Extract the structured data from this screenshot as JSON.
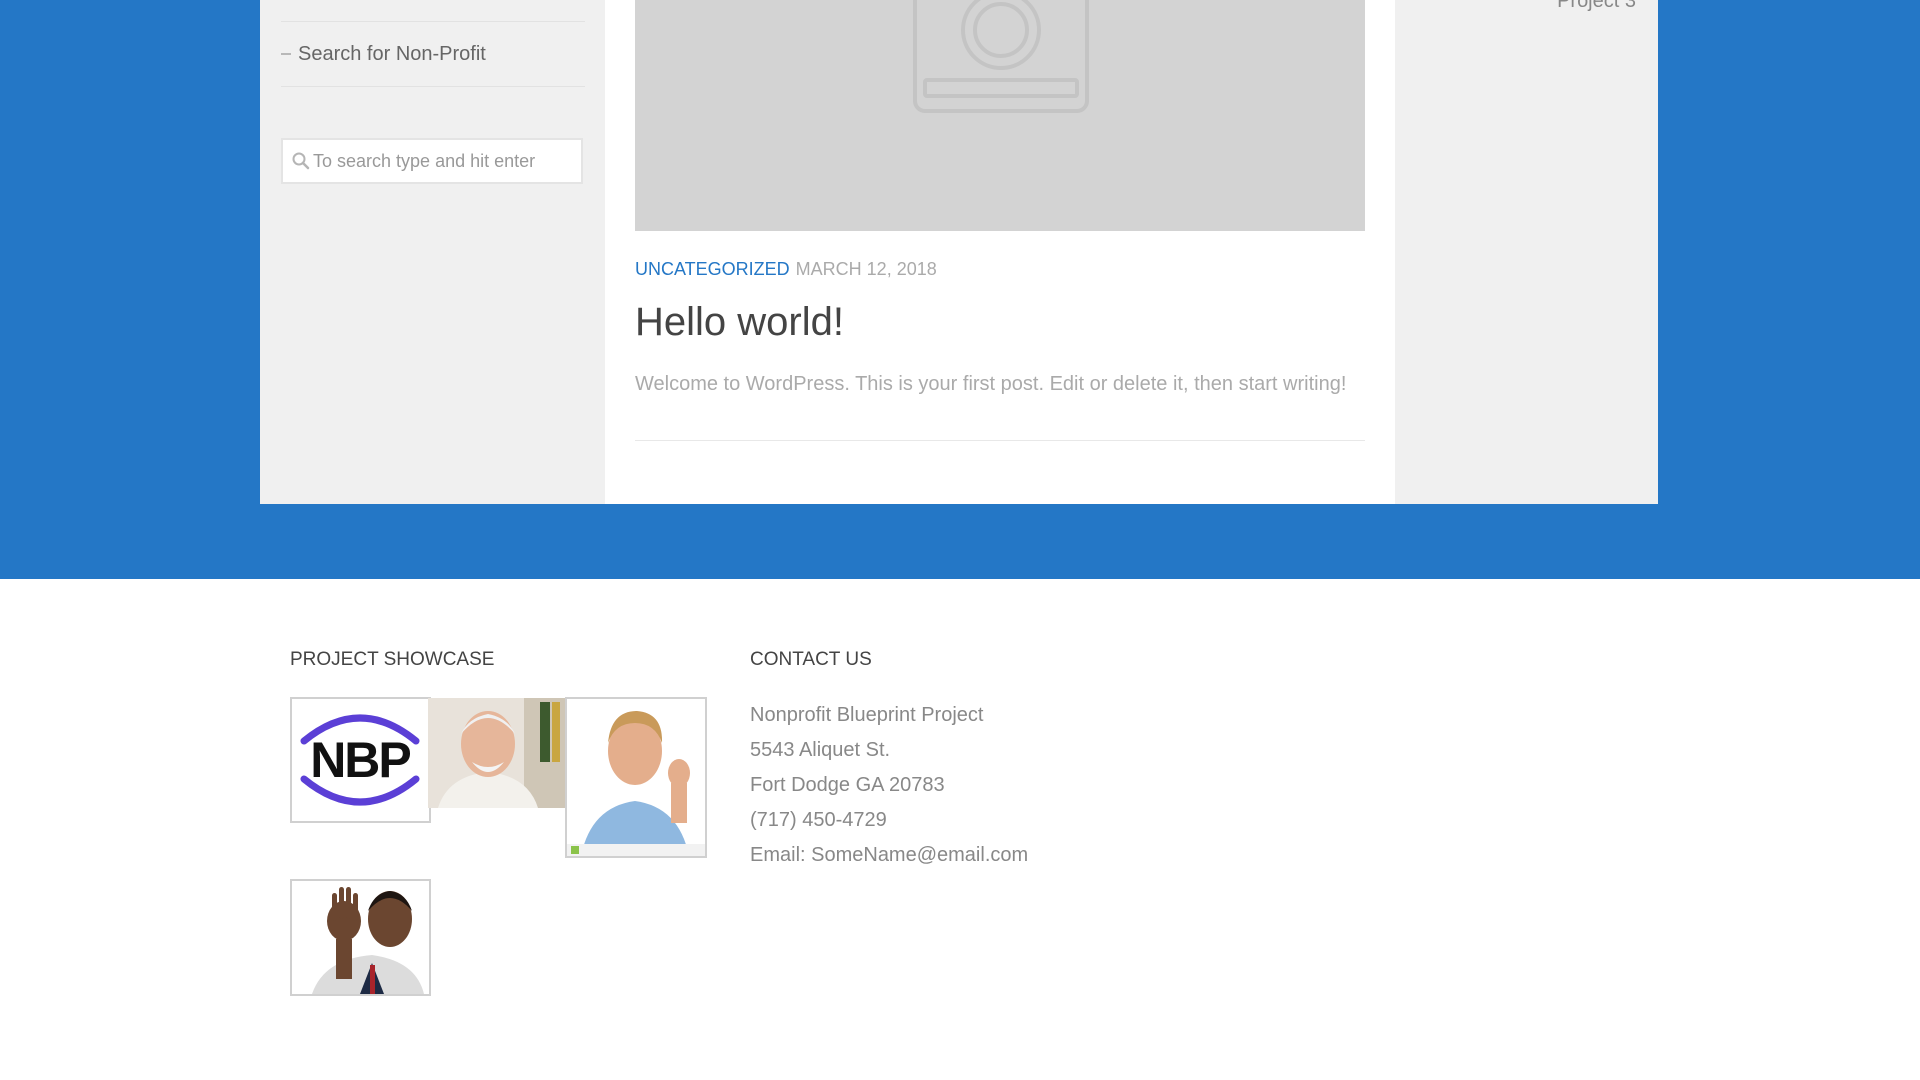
{
  "sidebar_left": {
    "nav_item": "Search for Non-Profit",
    "search_placeholder": "To search type and hit enter"
  },
  "post": {
    "category": "Uncategorized",
    "date": "March 12, 2018",
    "title": "Hello world!",
    "excerpt": "Welcome to WordPress. This is your first post. Edit or delete it, then start writing!",
    "image_icon": "camera-placeholder-icon"
  },
  "sidebar_right": {
    "link": "Project 3"
  },
  "footer": {
    "showcase": {
      "heading": "Project Showcase",
      "thumbnails": [
        {
          "name": "nbp-logo",
          "text": "NBP"
        },
        {
          "name": "older-man-photo"
        },
        {
          "name": "man-ok-gesture-photo"
        },
        {
          "name": "man-waving-photo"
        }
      ]
    },
    "contact": {
      "heading": "Contact Us",
      "org": "Nonprofit Blueprint Project",
      "street": "5543 Aliquet St.",
      "city": "Fort Dodge GA 20783",
      "phone": "(717) 450-4729",
      "email": "Email: SomeName@email.com"
    }
  },
  "colors": {
    "brand_blue": "#2477c6",
    "sidebar_gray": "#f0f0f0",
    "logo_purple": "#5b3fd6"
  }
}
